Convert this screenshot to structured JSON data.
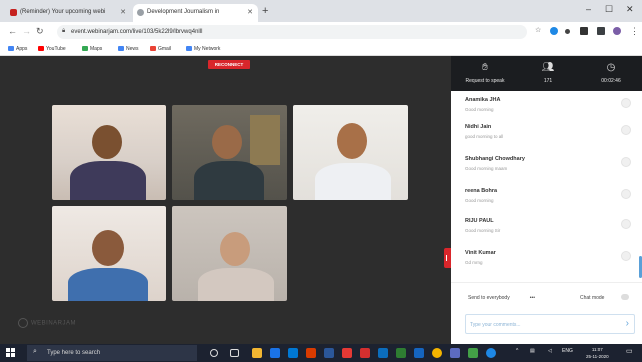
{
  "browser": {
    "tabs": [
      {
        "label": "(Reminder) Your upcoming webi",
        "favicon_color": "#c5221f"
      },
      {
        "label": "Development Journalism in",
        "favicon_color": "#5f6368"
      }
    ],
    "url": "event.webinarjam.com/live/103/5k22l9/lbrvwq4nlll",
    "bookmarks": [
      {
        "label": "Apps",
        "color": "#4285f4"
      },
      {
        "label": "YouTube",
        "color": "#ff0000"
      },
      {
        "label": "Maps",
        "color": "#34a853"
      },
      {
        "label": "News",
        "color": "#4285f4"
      },
      {
        "label": "Gmail",
        "color": "#ea4335"
      },
      {
        "label": "My Network",
        "color": "#4285f4"
      }
    ]
  },
  "stage": {
    "reconnect_label": "RECONNECT",
    "watermark": "WEBINARJAM"
  },
  "panel": {
    "header": [
      {
        "icon": "hand-icon",
        "label": "Request to speak"
      },
      {
        "icon": "people-icon",
        "label": "171"
      },
      {
        "icon": "clock-icon",
        "label": "00:02:46"
      }
    ],
    "messages": [
      {
        "name": "Anamika JHA",
        "text": "Good morning"
      },
      {
        "name": "Nidhi Jain",
        "text": "good morning to all"
      },
      {
        "name": "Shubhangi Chowdhary",
        "text": "Good morning maam"
      },
      {
        "name": "reena Bohra",
        "text": "Good morning"
      },
      {
        "name": "RIJU PAUL",
        "text": "Good morning Sir"
      },
      {
        "name": "Vinit Kumar",
        "text": "Gd mrng"
      }
    ],
    "send_to": "Send to everybody",
    "chat_mode": "Chat mode",
    "input_placeholder": "Type your comments..."
  },
  "taskbar": {
    "search_placeholder": "Type here to search",
    "language": "ENG",
    "time": "11:07",
    "date": "25-11-2020"
  },
  "colors": {
    "accent_red": "#d9262b",
    "panel_header": "#1b1d20",
    "stage_bg": "#2d2d2d"
  }
}
